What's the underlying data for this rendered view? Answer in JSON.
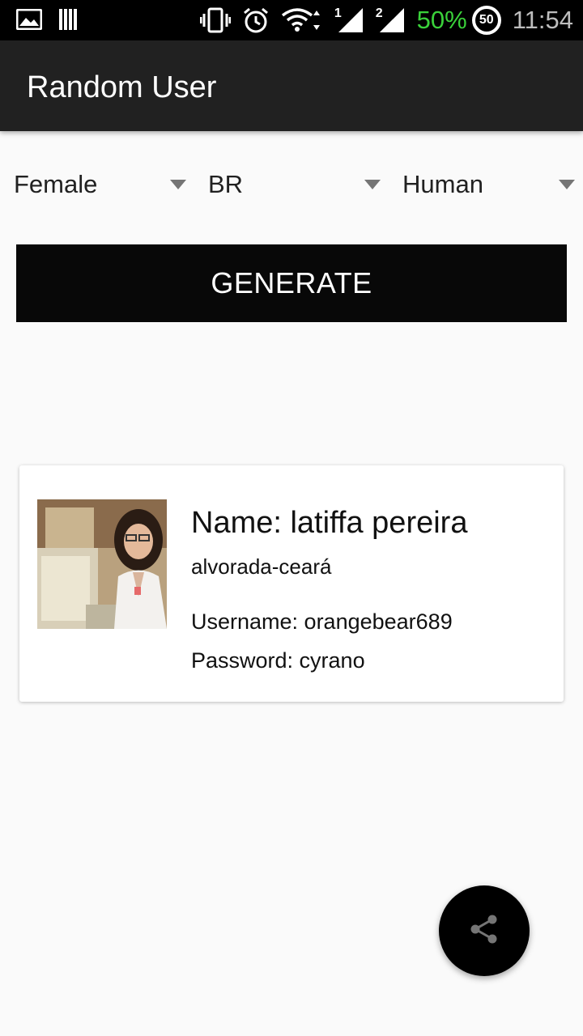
{
  "status_bar": {
    "signal_1": "1",
    "signal_2": "2",
    "battery_percent": "50%",
    "battery_ring": "50",
    "time": "11:54",
    "icons": [
      "image-icon",
      "sim-icon",
      "vibrate-icon",
      "alarm-icon",
      "wifi-icon",
      "signal-icon",
      "battery-icon"
    ]
  },
  "app_bar": {
    "title": "Random User"
  },
  "filters": {
    "gender": "Female",
    "nationality": "BR",
    "type": "Human"
  },
  "generate_button": {
    "label": "GENERATE"
  },
  "user_card": {
    "name": "Name: latiffa pereira",
    "location": "alvorada-ceará",
    "username": "Username: orangebear689",
    "password": "Password: cyrano"
  },
  "fab": {
    "icon": "share-icon"
  },
  "colors": {
    "app_bar": "#212121",
    "button": "#080808",
    "battery_text": "#3ad13a",
    "background": "#fafafa"
  }
}
